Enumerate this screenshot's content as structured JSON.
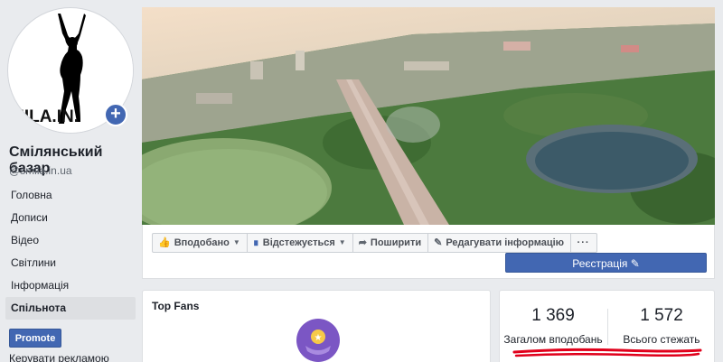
{
  "page": {
    "name": "Смілянський базар",
    "handle": "@smila.in.ua",
    "avatar_logo_text": "MILA.IN."
  },
  "nav": {
    "items": [
      {
        "label": "Головна"
      },
      {
        "label": "Дописи"
      },
      {
        "label": "Відео"
      },
      {
        "label": "Світлини"
      },
      {
        "label": "Інформація"
      },
      {
        "label": "Спільнота"
      }
    ],
    "active": "Спільнота"
  },
  "promote": {
    "label": "Promote"
  },
  "manage_ads": {
    "label": "Керувати рекламою"
  },
  "actions": {
    "liked": "Вподобано",
    "following": "Відстежується",
    "share": "Поширити",
    "edit": "Редагувати інформацію",
    "more": "···"
  },
  "register": {
    "label": "Реєстрація",
    "icon": "pencil-icon"
  },
  "top_fans": {
    "title": "Top Fans"
  },
  "stats": {
    "likes": {
      "value": "1 369",
      "label": "Загалом вподобань"
    },
    "followers": {
      "value": "1 572",
      "label": "Всього стежать"
    }
  },
  "colors": {
    "brand": "#4267b2",
    "background": "#e9ebee",
    "highlight": "#e0001b"
  }
}
